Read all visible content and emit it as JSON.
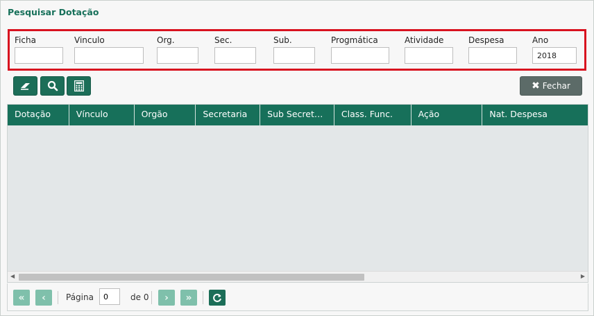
{
  "title": "Pesquisar Dotação",
  "filters": [
    {
      "label": "Ficha",
      "value": ""
    },
    {
      "label": "Vinculo",
      "value": ""
    },
    {
      "label": "Org.",
      "value": ""
    },
    {
      "label": "Sec.",
      "value": ""
    },
    {
      "label": "Sub.",
      "value": ""
    },
    {
      "label": "Progmática",
      "value": ""
    },
    {
      "label": "Atividade",
      "value": ""
    },
    {
      "label": "Despesa",
      "value": ""
    },
    {
      "label": "Ano",
      "value": "2018"
    }
  ],
  "toolbar": {
    "icons": [
      "eraser-icon",
      "search-icon",
      "calculator-icon"
    ],
    "close_label": "Fechar"
  },
  "grid": {
    "columns": [
      "Dotação",
      "Vínculo",
      "Orgão",
      "Secretaria",
      "Sub Secret…",
      "Class. Func.",
      "Ação",
      "Nat. Despesa"
    ],
    "rows": []
  },
  "pager": {
    "page_label": "Página",
    "page_value": "0",
    "of_label": "de 0"
  },
  "colors": {
    "primary": "#17705a",
    "highlight_border": "#d8121f",
    "close_button": "#5c6b68",
    "pager_disabled": "#7fc0ab"
  }
}
